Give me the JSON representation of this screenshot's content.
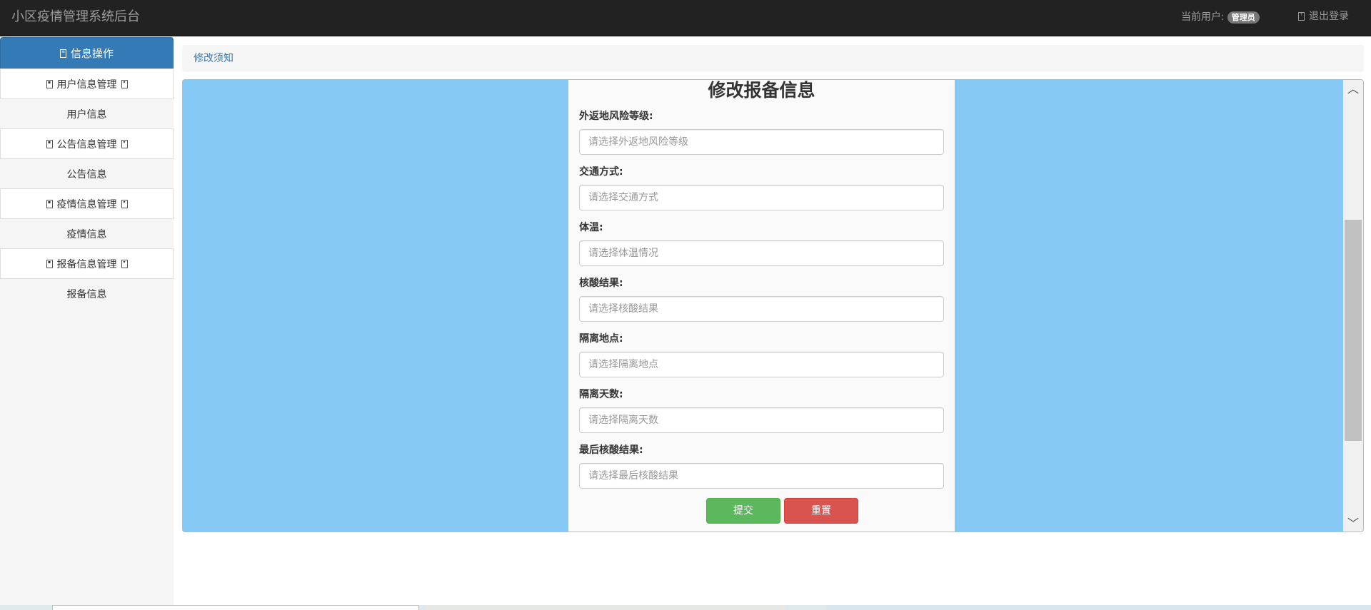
{
  "navbar": {
    "brand": "小区疫情管理系统后台",
    "current_user_label": "当前用户:",
    "current_user_role": "管理员",
    "logout_label": "退出登录",
    "logout_icon": "log-out-icon"
  },
  "sidebar": {
    "header": {
      "label": "信息操作",
      "icon": "list-icon"
    },
    "groups": [
      {
        "label": "用户信息管理",
        "icon": "chevron-down-icon",
        "link": "用户信息"
      },
      {
        "label": "公告信息管理",
        "icon": "chevron-down-icon",
        "link": "公告信息"
      },
      {
        "label": "疫情信息管理",
        "icon": "chevron-down-icon",
        "link": "疫情信息"
      },
      {
        "label": "报备信息管理",
        "icon": "chevron-down-icon",
        "link": "报备信息"
      }
    ]
  },
  "breadcrumb": {
    "label": "修改须知"
  },
  "form": {
    "title": "修改报备信息",
    "fields": [
      {
        "label": "外返地风险等级:",
        "placeholder": "请选择外返地风险等级"
      },
      {
        "label": "交通方式:",
        "placeholder": "请选择交通方式"
      },
      {
        "label": "体温:",
        "placeholder": "请选择体温情况"
      },
      {
        "label": "核酸结果:",
        "placeholder": "请选择核酸结果"
      },
      {
        "label": "隔离地点:",
        "placeholder": "请选择隔离地点"
      },
      {
        "label": "隔离天数:",
        "placeholder": "请选择隔离天数"
      },
      {
        "label": "最后核酸结果:",
        "placeholder": "请选择最后核酸结果"
      }
    ],
    "submit_label": "提交",
    "reset_label": "重置"
  },
  "colors": {
    "navbar": "#222222",
    "primary": "#337ab7",
    "frame_background": "#87c9f5",
    "success": "#5cb85c",
    "danger": "#d9534f"
  }
}
